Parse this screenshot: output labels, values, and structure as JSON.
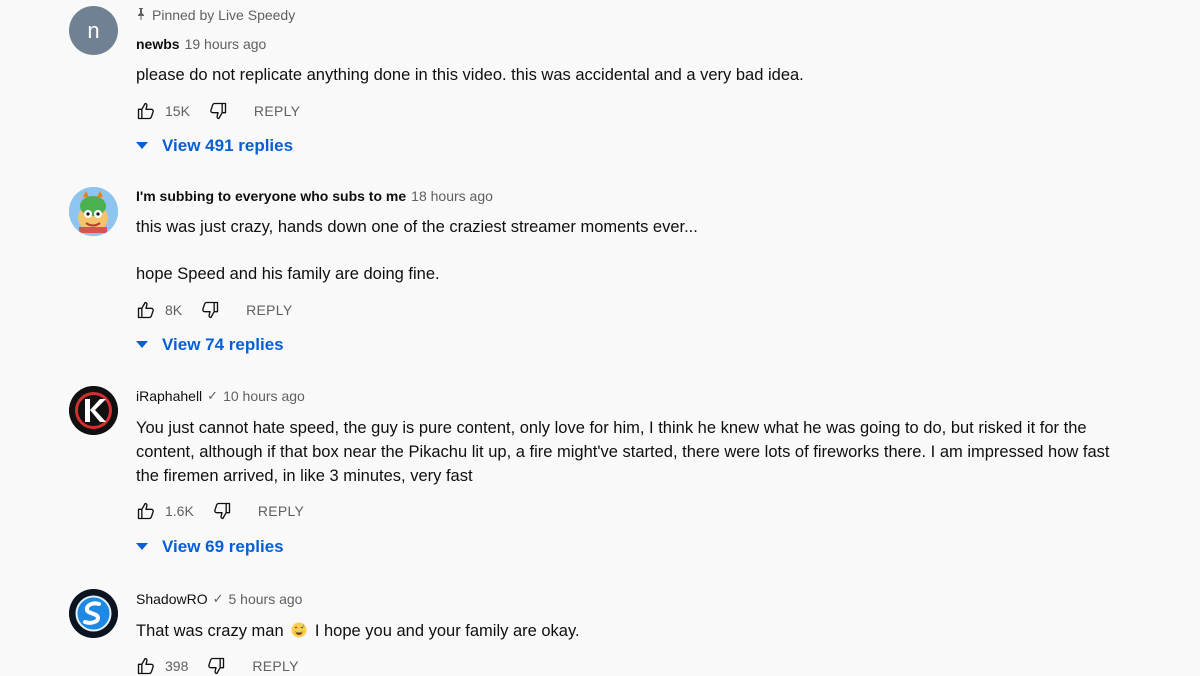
{
  "comments": [
    {
      "pinned_label": "Pinned by Live Speedy",
      "avatar_letter": "n",
      "author": "newbs",
      "time": "19 hours ago",
      "verified": "",
      "lines": [
        "please do not replicate anything done in this video. this was accidental and a very bad idea."
      ],
      "likes": "15K",
      "reply_label": "REPLY",
      "view_replies": "View 491 replies"
    },
    {
      "author": "I'm subbing to everyone who subs to me",
      "time": "18 hours ago",
      "paragraph1": "this was just crazy, hands down one of the craziest streamer moments ever...",
      "paragraph2": "hope Speed and his family are doing fine.",
      "likes": "8K",
      "reply_label": "REPLY",
      "view_replies": "View 74 replies"
    },
    {
      "author": "iRaphahell",
      "time": "10 hours ago",
      "lines": [
        "You just cannot hate speed, the guy is pure content, only love for him, I think he knew what he was going to do, but risked it for the",
        "content, although if that box near the Pikachu lit up, a fire might've started, there were lots of fireworks there. I am impressed how fast",
        "the firemen arrived, in like 3 minutes, very fast"
      ],
      "likes": "1.6K",
      "reply_label": "REPLY",
      "view_replies": "View 69 replies"
    },
    {
      "author": "ShadowRO",
      "time": "5 hours ago",
      "text_before_emoji": "That was crazy man",
      "text_after_emoji": "I hope you and your family are okay.",
      "likes": "398",
      "reply_label": "REPLY"
    }
  ],
  "colors": {
    "background": "#f9f9f9",
    "link_blue": "#065fd4",
    "secondary_text": "#606060",
    "avatar_gray": "#6f8192"
  }
}
